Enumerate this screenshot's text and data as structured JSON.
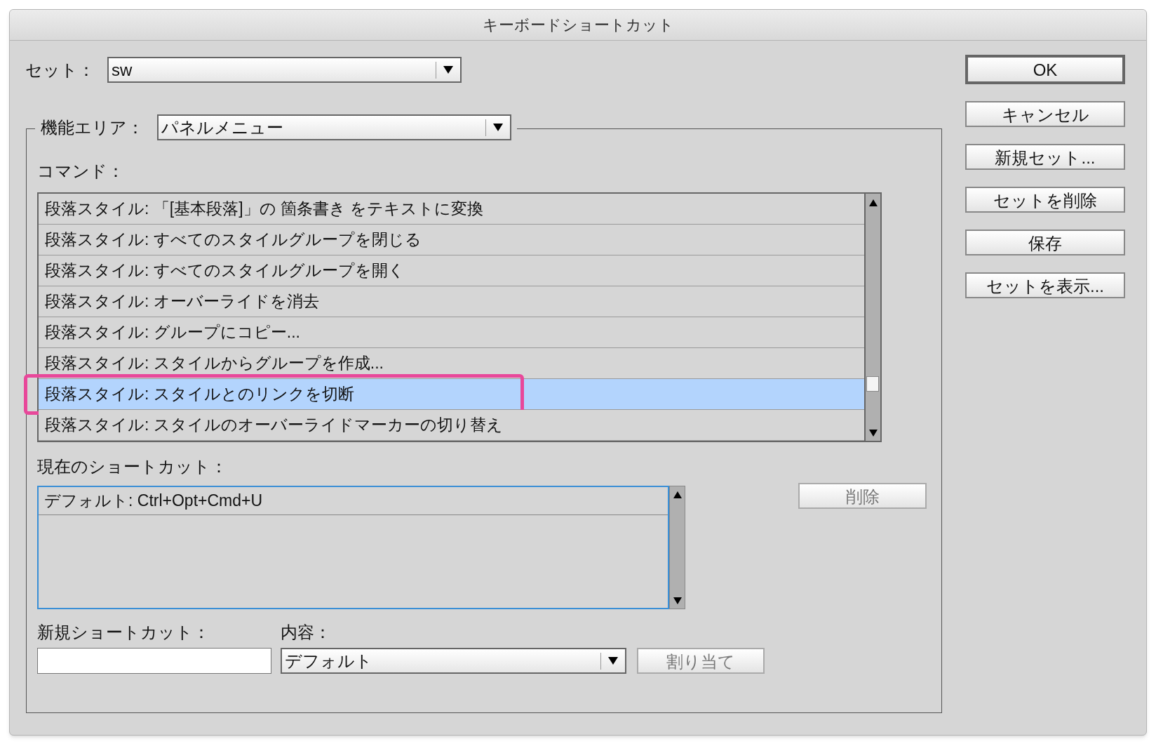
{
  "window": {
    "title": "キーボードショートカット"
  },
  "set": {
    "label": "セット：",
    "value": "sw"
  },
  "buttons": [
    {
      "label": "OK",
      "default": true
    },
    {
      "label": "キャンセル",
      "default": false
    },
    {
      "label": "新規セット...",
      "default": false
    },
    {
      "label": "セットを削除",
      "default": false
    },
    {
      "label": "保存",
      "default": false
    },
    {
      "label": "セットを表示...",
      "default": false
    }
  ],
  "area": {
    "label": "機能エリア：",
    "value": "パネルメニュー"
  },
  "commands": {
    "label": "コマンド：",
    "rows": [
      {
        "text": "段落スタイル: 「[基本段落]」の 箇条書き をテキストに変換",
        "selected": false
      },
      {
        "text": "段落スタイル: すべてのスタイルグループを閉じる",
        "selected": false
      },
      {
        "text": "段落スタイル: すべてのスタイルグループを開く",
        "selected": false
      },
      {
        "text": "段落スタイル: オーバーライドを消去",
        "selected": false
      },
      {
        "text": "段落スタイル: グループにコピー...",
        "selected": false
      },
      {
        "text": "段落スタイル: スタイルからグループを作成...",
        "selected": false
      },
      {
        "text": "段落スタイル: スタイルとのリンクを切断",
        "selected": true
      },
      {
        "text": "段落スタイル: スタイルのオーバーライドマーカーの切り替え",
        "selected": false
      }
    ]
  },
  "current_shortcuts": {
    "label": "現在のショートカット：",
    "rows": [
      {
        "text": "デフォルト: Ctrl+Opt+Cmd+U"
      }
    ]
  },
  "remove_button": {
    "label": "削除",
    "disabled": true
  },
  "new_shortcut": {
    "label": "新規ショートカット："
  },
  "context": {
    "label": "内容：",
    "value": "デフォルト"
  },
  "assign_button": {
    "label": "割り当て",
    "disabled": true
  }
}
